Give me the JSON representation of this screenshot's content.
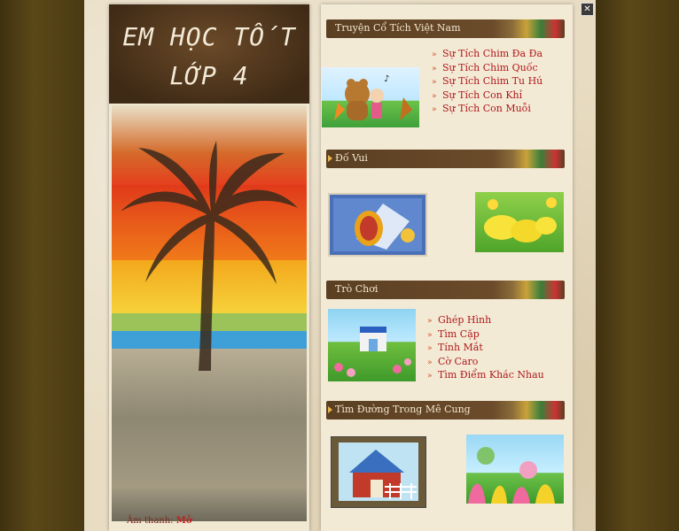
{
  "site": {
    "title_line1": "EM HỌC TỐT",
    "title_line2": "LỚP 4",
    "sound_label": "Âm thanh:",
    "sound_value": "Mở"
  },
  "sections": {
    "truyen": {
      "header": "Truyện Cổ Tích Việt Nam",
      "links": [
        "Sự Tích Chim Đa Đa",
        "Sự Tích Chim Quốc",
        "Sự Tích Chim Tu Hú",
        "Sự Tích Con Khỉ",
        "Sự Tích Con Muỗi"
      ]
    },
    "dovui": {
      "header": "Đố Vui"
    },
    "trochoi": {
      "header": "Trò Chơi",
      "links": [
        "Ghép Hình",
        "Tìm Cặp",
        "Tính Mắt",
        "Cờ Caro",
        "Tìm Điểm Khác Nhau"
      ]
    },
    "meCung": {
      "header": "Tìm Đường Trong Mê Cung"
    }
  },
  "controls": {
    "close_symbol": "✕"
  }
}
